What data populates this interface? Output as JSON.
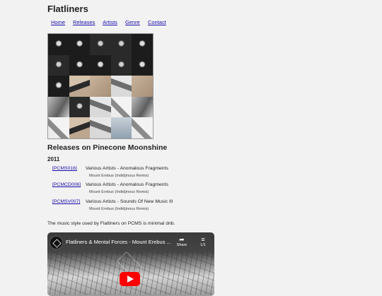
{
  "site": {
    "title": "Flatliners"
  },
  "nav": [
    {
      "label": "Home"
    },
    {
      "label": "Releases"
    },
    {
      "label": "Artists"
    },
    {
      "label": "Genre"
    },
    {
      "label": "Contact"
    }
  ],
  "covers": [
    "dark",
    "dark",
    "dark2",
    "dark2",
    "dark",
    "dark2",
    "dark",
    "dark",
    "dark2",
    "dark",
    "dark",
    "tanmark",
    "tan",
    "light",
    "tan",
    "grey",
    "dark2",
    "light",
    "light2",
    "grey",
    "light2",
    "tanmark",
    "light",
    "blueish",
    "light2"
  ],
  "section": {
    "title": "Releases on Pinecone Moonshine",
    "year": "2011"
  },
  "releases": [
    {
      "cat": "[PCMS016]",
      "info": "Various Artists - Anomalous Fragments",
      "remix": "Mount Erebus (Indidjinous Remix)"
    },
    {
      "cat": "[PCMCD006]",
      "info": "Various Artists - Anomalous Fragments",
      "remix": "Mount Erebus (Indidjinous Remix)"
    },
    {
      "cat": "[PCMSV007]",
      "info": "Various Artists - Sounds Of New Music III",
      "remix": "Mount Erebus (Indidjinous Remix)"
    }
  ],
  "style_note": "The music style used by Flatliners on PCMS is minimal dnb.",
  "video": {
    "title": "Flatliners & Mental Forces - Mount Erebus ...",
    "share_label": "Share",
    "playlist_count": "1/1"
  }
}
